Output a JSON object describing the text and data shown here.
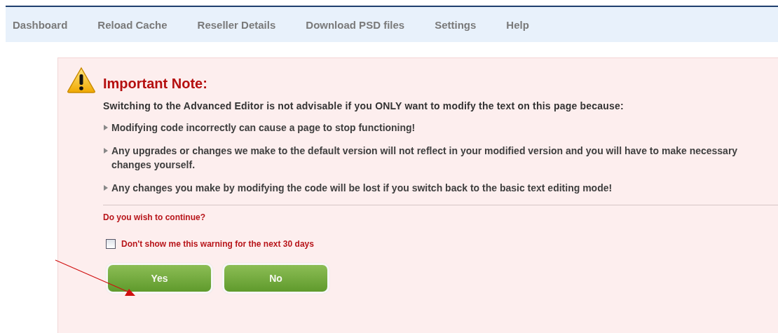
{
  "nav": {
    "items": [
      {
        "label": "Dashboard"
      },
      {
        "label": "Reload Cache"
      },
      {
        "label": "Reseller Details"
      },
      {
        "label": "Download PSD files"
      },
      {
        "label": "Settings"
      },
      {
        "label": "Help"
      }
    ]
  },
  "note": {
    "title": "Important Note:",
    "intro": "Switching to the Advanced Editor is not advisable if you ONLY want to modify the text on this page because:",
    "bullets": [
      "Modifying code incorrectly can cause a page to stop functioning!",
      "Any upgrades or changes we make to the default version will not reflect in your modified version and you will have to make necessary changes yourself.",
      "Any changes you make by modifying the code will be lost if you switch back to the basic text editing mode!"
    ],
    "question": "Do you wish to continue?",
    "checkbox": {
      "label": "Don't show me this warning for the next 30 days",
      "checked": false
    },
    "buttons": [
      "Yes",
      "No"
    ]
  }
}
